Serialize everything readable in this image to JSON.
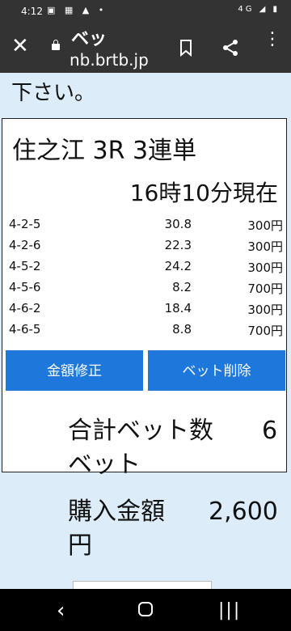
{
  "statusbar": {
    "time": "4:12",
    "left_icons": "▣ ▦ ▲ •",
    "right_icons": "4G ◢ ▮"
  },
  "toolbar": {
    "title": "ベッ",
    "url": "nb.brtb.jp"
  },
  "page": {
    "instruction": "下さい。"
  },
  "bet_card": {
    "race": "住之江 3R 3連単",
    "as_of": "16時10分現在",
    "rows": [
      {
        "combo": "4-2-5",
        "odds": "30.8",
        "amount": "300円"
      },
      {
        "combo": "4-2-6",
        "odds": "22.3",
        "amount": "300円"
      },
      {
        "combo": "4-5-2",
        "odds": "24.2",
        "amount": "300円"
      },
      {
        "combo": "4-5-6",
        "odds": "8.2",
        "amount": "700円"
      },
      {
        "combo": "4-6-2",
        "odds": "18.4",
        "amount": "300円"
      },
      {
        "combo": "4-6-5",
        "odds": "8.8",
        "amount": "700円"
      }
    ],
    "edit_button": "金額修正",
    "delete_button": "ベット削除"
  },
  "summary": {
    "total_bets_label": "合計ベット数",
    "total_bets_value": "6",
    "total_bets_unit": "ベット",
    "purchase_label": "購入金額",
    "purchase_value": "2,600",
    "purchase_unit": "円"
  }
}
